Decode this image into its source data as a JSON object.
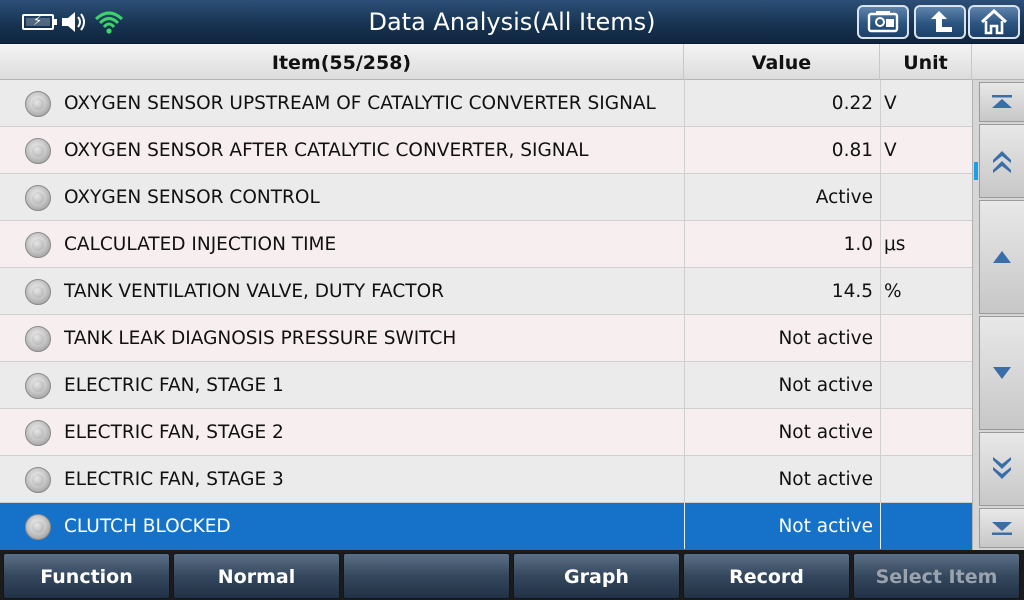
{
  "header": {
    "title": "Data Analysis(All Items)"
  },
  "table": {
    "columns": {
      "item": "Item(55/258)",
      "value": "Value",
      "unit": "Unit"
    },
    "rows": [
      {
        "item": "OXYGEN SENSOR UPSTREAM OF CATALYTIC CONVERTER SIGNAL",
        "value": "0.22",
        "unit": "V"
      },
      {
        "item": "OXYGEN SENSOR AFTER CATALYTIC CONVERTER, SIGNAL",
        "value": "0.81",
        "unit": "V"
      },
      {
        "item": "OXYGEN SENSOR CONTROL",
        "value": "Active",
        "unit": ""
      },
      {
        "item": "CALCULATED INJECTION TIME",
        "value": "1.0",
        "unit": "μs"
      },
      {
        "item": "TANK VENTILATION VALVE, DUTY FACTOR",
        "value": "14.5",
        "unit": "%"
      },
      {
        "item": "TANK LEAK DIAGNOSIS PRESSURE SWITCH",
        "value": "Not active",
        "unit": ""
      },
      {
        "item": "ELECTRIC FAN, STAGE 1",
        "value": "Not active",
        "unit": ""
      },
      {
        "item": "ELECTRIC FAN, STAGE 2",
        "value": "Not active",
        "unit": ""
      },
      {
        "item": "ELECTRIC FAN, STAGE 3",
        "value": "Not active",
        "unit": ""
      },
      {
        "item": "CLUTCH BLOCKED",
        "value": "Not active",
        "unit": ""
      }
    ],
    "selected_row": 9
  },
  "toolbar": {
    "function_label": "Function",
    "normal_label": "Normal",
    "empty_label": "",
    "graph_label": "Graph",
    "record_label": "Record",
    "select_item_label": "Select Item"
  },
  "icons": {
    "battery": "battery-charging-icon",
    "speaker": "speaker-icon",
    "wifi": "wifi-icon",
    "screenshot": "screenshot-icon",
    "back": "back-arrow-icon",
    "home": "home-icon"
  },
  "colors": {
    "header_bg": "#16324f",
    "selected_row": "#1672c9",
    "wifi": "#3bd36a",
    "scroll_indicator": "#1aa0e6"
  }
}
